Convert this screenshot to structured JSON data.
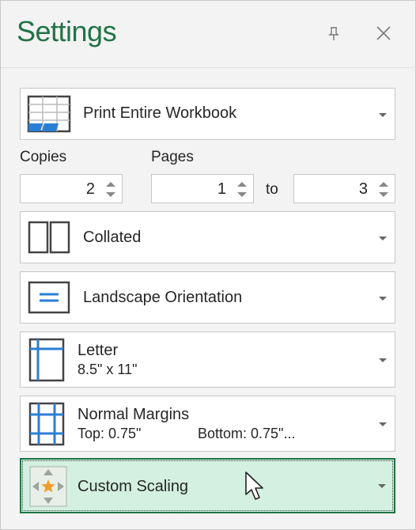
{
  "header": {
    "title": "Settings"
  },
  "print_what": {
    "label": "Print Entire Workbook"
  },
  "copies": {
    "label": "Copies",
    "value": "2"
  },
  "pages": {
    "label": "Pages",
    "from": "1",
    "to_label": "to",
    "to": "3"
  },
  "collation": {
    "label": "Collated"
  },
  "orientation": {
    "label": "Landscape Orientation"
  },
  "paper": {
    "label": "Letter",
    "detail": "8.5\" x 11\""
  },
  "margins": {
    "label": "Normal Margins",
    "top": "Top: 0.75\"",
    "bottom": "Bottom: 0.75\"..."
  },
  "scaling": {
    "label": "Custom Scaling"
  },
  "colors": {
    "accent": "#217346",
    "icon_blue": "#2a7fd4",
    "active_bg": "#d3f0e0"
  }
}
